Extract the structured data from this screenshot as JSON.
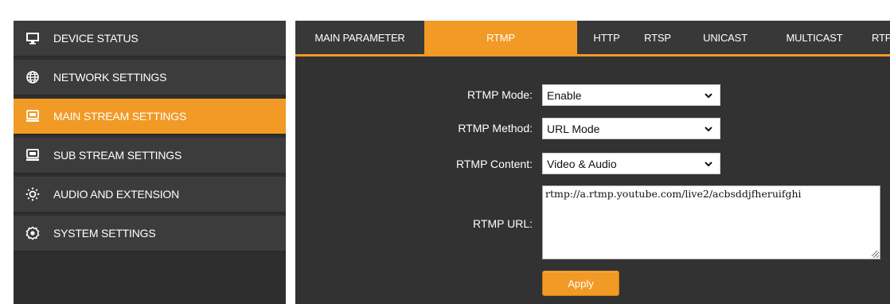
{
  "sidebar": {
    "items": [
      {
        "label": "DEVICE STATUS",
        "icon": "monitor-icon",
        "active": false
      },
      {
        "label": "NETWORK SETTINGS",
        "icon": "globe-icon",
        "active": false
      },
      {
        "label": "MAIN STREAM SETTINGS",
        "icon": "stream-device-icon",
        "active": true
      },
      {
        "label": "SUB STREAM SETTINGS",
        "icon": "stream-device-icon",
        "active": false
      },
      {
        "label": "AUDIO AND EXTENSION",
        "icon": "audio-settings-icon",
        "active": false
      },
      {
        "label": "SYSTEM SETTINGS",
        "icon": "gear-icon",
        "active": false
      }
    ]
  },
  "tabs": [
    {
      "label": "MAIN PARAMETER",
      "active": false
    },
    {
      "label": "RTMP",
      "active": true
    },
    {
      "label": "HTTP",
      "active": false
    },
    {
      "label": "RTSP",
      "active": false
    },
    {
      "label": "UNICAST",
      "active": false
    },
    {
      "label": "MULTICAST",
      "active": false
    },
    {
      "label": "RTP",
      "active": false
    }
  ],
  "form": {
    "rtmp_mode": {
      "label": "RTMP Mode:",
      "value": "Enable"
    },
    "rtmp_method": {
      "label": "RTMP Method:",
      "value": "URL Mode"
    },
    "rtmp_content": {
      "label": "RTMP Content:",
      "value": "Video & Audio"
    },
    "rtmp_url": {
      "label": "RTMP URL:",
      "value": "rtmp://a.rtmp.youtube.com/live2/acbsddjfheruifghi"
    },
    "apply_label": "Apply"
  },
  "colors": {
    "accent": "#f19a25",
    "sidebar_item": "#3c3c3c",
    "panel": "#323232"
  }
}
